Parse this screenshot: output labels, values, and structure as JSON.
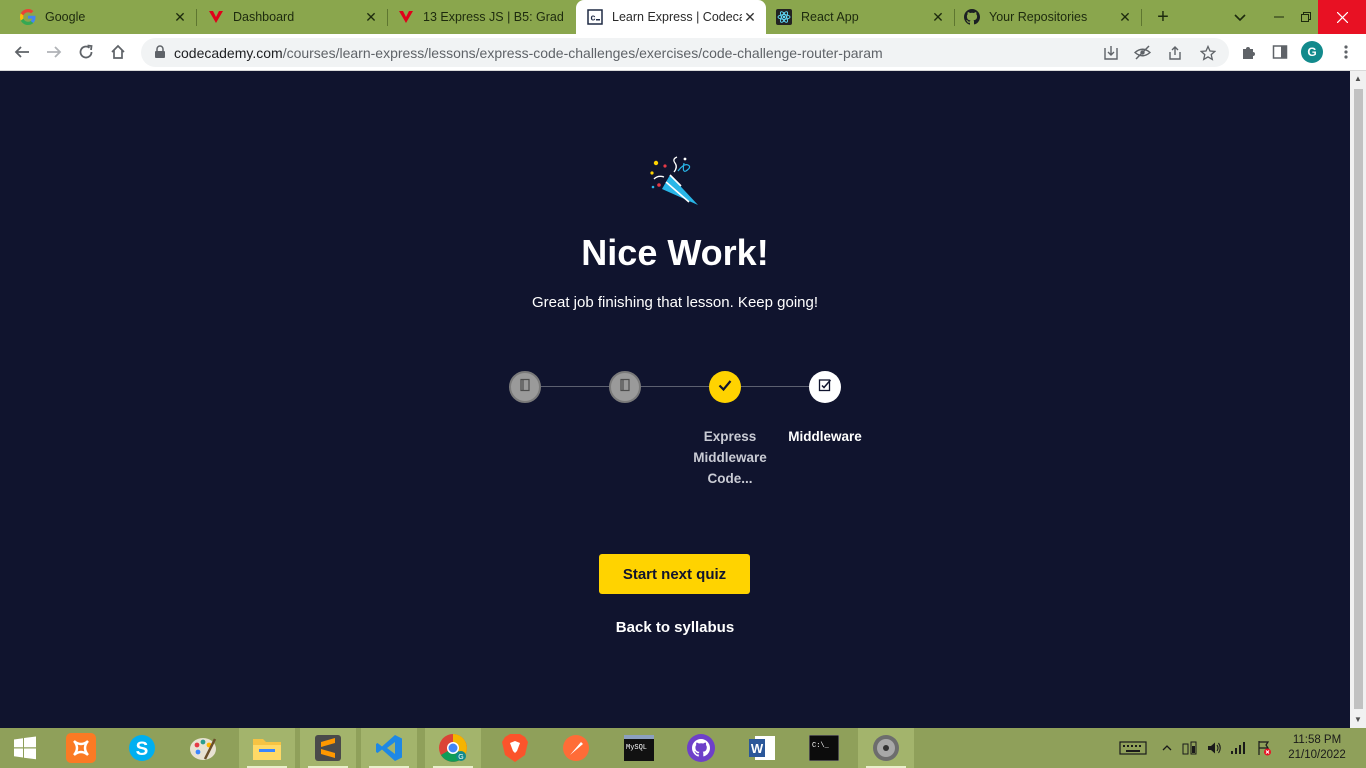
{
  "browser": {
    "tabs": [
      {
        "title": "Google",
        "icon": "google-icon",
        "active": false
      },
      {
        "title": "Dashboard",
        "icon": "vercel-logo-icon",
        "active": false
      },
      {
        "title": "13 Express JS | B5: Grad",
        "icon": "vercel-logo-icon",
        "active": false
      },
      {
        "title": "Learn Express | Codecad",
        "icon": "codecademy-icon",
        "active": true
      },
      {
        "title": "React App",
        "icon": "react-icon",
        "active": false
      },
      {
        "title": "Your Repositories",
        "icon": "github-icon",
        "active": false
      }
    ],
    "url_host": "codecademy.com",
    "url_path": "/courses/learn-express/lessons/express-code-challenges/exercises/code-challenge-router-param",
    "profile_initial": "G"
  },
  "page": {
    "title": "Nice Work!",
    "subtitle": "Great job finishing that lesson. Keep going!",
    "steps": [
      {
        "label": "",
        "status": "done",
        "icon": "book-icon"
      },
      {
        "label": "",
        "status": "done",
        "icon": "book-icon"
      },
      {
        "label": "Express Middleware Code...",
        "status": "complete",
        "icon": "check-icon"
      },
      {
        "label": "Middleware",
        "status": "next",
        "icon": "quiz-icon"
      }
    ],
    "primary_button": "Start next quiz",
    "secondary_link": "Back to syllabus"
  },
  "taskbar": {
    "apps": [
      "windows-start-icon",
      "xampp-icon",
      "skype-icon",
      "paint-icon",
      "file-explorer-icon",
      "sublime-text-icon",
      "vscode-icon",
      "chrome-icon",
      "brave-icon",
      "postman-icon",
      "mysql-console-icon",
      "github-desktop-icon",
      "word-icon",
      "cmd-icon",
      "media-player-icon"
    ],
    "time": "11:58 PM",
    "date": "21/10/2022"
  },
  "colors": {
    "page_bg": "#10142e",
    "accent_yellow": "#ffd300",
    "tabstrip_bg": "#8aa64d",
    "taskbar_bg": "#8fa05a"
  }
}
